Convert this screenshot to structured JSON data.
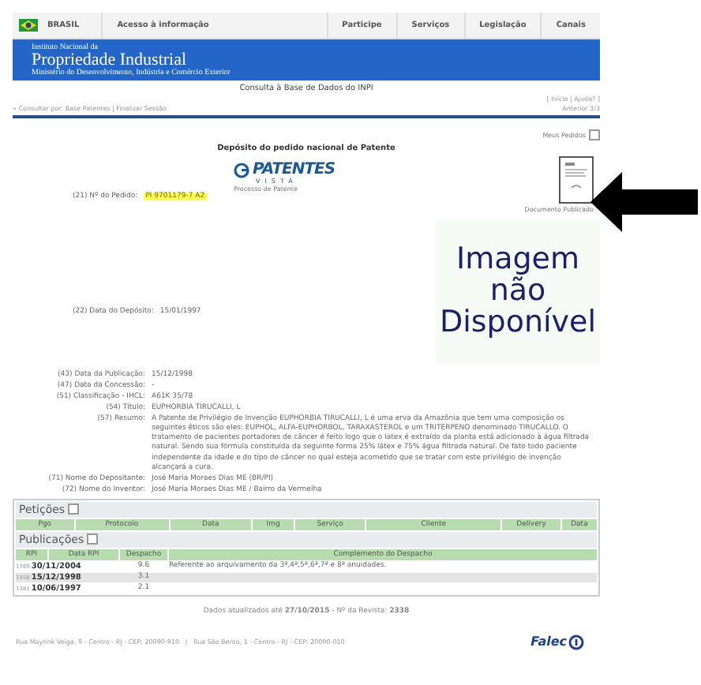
{
  "top_nav": {
    "brand": "BRASIL",
    "items": [
      "Acesso à informação",
      "Participe",
      "Serviços",
      "Legislação",
      "Canais"
    ]
  },
  "banner": {
    "line1": "Instituto Nacional da",
    "line2": "Propriedade Industrial",
    "line3": "Ministério do Desenvolvimento, Indústria e Comércio Exterior"
  },
  "subtitle": "Consulta à Base de Dados do INPI",
  "breadcrumb": {
    "prefix": "» Consultar por:",
    "links": [
      "Base Patentes",
      "Finalizar Sessão"
    ]
  },
  "top_links": [
    "Início",
    "Ajuda?"
  ],
  "separator": "|",
  "brackets": [
    "[",
    "]"
  ],
  "pager": "Anterior 3/3",
  "my_requests": "Meus Pedidos",
  "heading": "Depósito do pedido nacional de Patente",
  "application": {
    "label": "(21) Nº do Pedido:",
    "value": "PI 9701179-7 A2"
  },
  "logo": {
    "name": "PATENTES",
    "sub": "VISTA",
    "caption": "Processo de Patente"
  },
  "document": {
    "caption": "Documento Publicado"
  },
  "filing": {
    "label": "(22) Data do Depósito:",
    "value": "15/01/1997"
  },
  "image_placeholder": "Imagem não Disponível",
  "fields": [
    {
      "label": "(43) Data da Publicação:",
      "value": "15/12/1998"
    },
    {
      "label": "(47) Data da Concessão:",
      "value": "-"
    },
    {
      "label": "(51) Classificação - IHCL:",
      "value": "A61K 35/78"
    },
    {
      "label": "(54) Título:",
      "value": "EUPHORBIA TIRUCALLI, L"
    },
    {
      "label": "(57) Resumo:",
      "value": "A Patente de Privilégio de Invenção EUPHORBIA TIRUCALLI, L é uma erva da Amazônia que tem uma composição os seguintes êticos são eles: EUPHOL, ALFA-EUPHORBOL, TARAXASTEROL e um TRITERPENO denominado TIRUCALLO. O tratamento de pacientes portadores de câncer é feito logo que o latex é extraído da planta está adicionado à água filtrada natural. Sendo sua fórmula constituída da seguinte forma 25% látex e 75% água filtrada natural. De fato todo paciente independente da idade e do tipo de câncer no qual esteja acometido que se tratar com este privilégio de invenção alcançará a cura."
    },
    {
      "label": "(71) Nome do Depositante:",
      "value": "José Maria Moraes Dias ME (BR/PI)"
    },
    {
      "label": "(72) Nome do Inventor:",
      "value": "José Maria Moraes Dias ME / Bairro da Vermelha"
    }
  ],
  "petitions": {
    "title": "Petições",
    "columns": [
      "Pgo",
      "Protocolo",
      "Data",
      "Img",
      "Serviço",
      "Cliente",
      "Delivery",
      "Data"
    ]
  },
  "publications": {
    "title": "Publicações",
    "columns": [
      "RPI",
      "Data RPI",
      "Despacho",
      "Complemento do Despacho"
    ],
    "rows": [
      {
        "rpi": "1769",
        "date": "30/11/2004",
        "code": "9.6",
        "complement": "Referente ao arquivamento da 3ª,4ª,5ª,6ª,7ª e 8ª anuidades."
      },
      {
        "rpi": "1458",
        "date": "15/12/1998",
        "code": "3.1"
      },
      {
        "rpi": "1381",
        "date": "10/06/1997",
        "code": "2.1"
      }
    ]
  },
  "updated": "Dados atualizados até **27/10/2015** - Nº da Revista: **2338**",
  "footer": {
    "address": "Rua Mayrink Veiga, 9 - Centro - RJ - CEP: 20090-910   |   Rua São Bento, 1 - Centro - RJ - CEP: 20090-010",
    "logo": "Falec"
  }
}
